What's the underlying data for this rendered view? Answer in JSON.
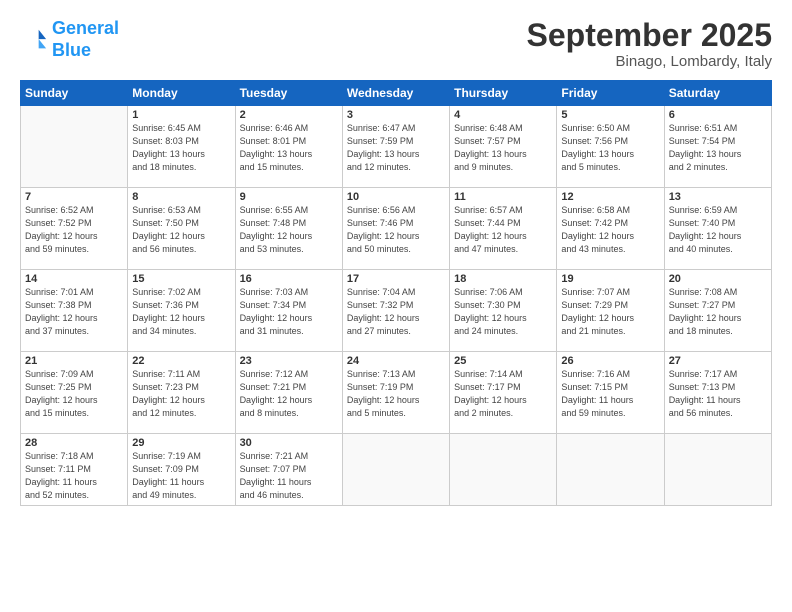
{
  "logo": {
    "line1": "General",
    "line2": "Blue"
  },
  "title": "September 2025",
  "location": "Binago, Lombardy, Italy",
  "days_of_week": [
    "Sunday",
    "Monday",
    "Tuesday",
    "Wednesday",
    "Thursday",
    "Friday",
    "Saturday"
  ],
  "weeks": [
    [
      {
        "day": "",
        "info": ""
      },
      {
        "day": "1",
        "info": "Sunrise: 6:45 AM\nSunset: 8:03 PM\nDaylight: 13 hours\nand 18 minutes."
      },
      {
        "day": "2",
        "info": "Sunrise: 6:46 AM\nSunset: 8:01 PM\nDaylight: 13 hours\nand 15 minutes."
      },
      {
        "day": "3",
        "info": "Sunrise: 6:47 AM\nSunset: 7:59 PM\nDaylight: 13 hours\nand 12 minutes."
      },
      {
        "day": "4",
        "info": "Sunrise: 6:48 AM\nSunset: 7:57 PM\nDaylight: 13 hours\nand 9 minutes."
      },
      {
        "day": "5",
        "info": "Sunrise: 6:50 AM\nSunset: 7:56 PM\nDaylight: 13 hours\nand 5 minutes."
      },
      {
        "day": "6",
        "info": "Sunrise: 6:51 AM\nSunset: 7:54 PM\nDaylight: 13 hours\nand 2 minutes."
      }
    ],
    [
      {
        "day": "7",
        "info": "Sunrise: 6:52 AM\nSunset: 7:52 PM\nDaylight: 12 hours\nand 59 minutes."
      },
      {
        "day": "8",
        "info": "Sunrise: 6:53 AM\nSunset: 7:50 PM\nDaylight: 12 hours\nand 56 minutes."
      },
      {
        "day": "9",
        "info": "Sunrise: 6:55 AM\nSunset: 7:48 PM\nDaylight: 12 hours\nand 53 minutes."
      },
      {
        "day": "10",
        "info": "Sunrise: 6:56 AM\nSunset: 7:46 PM\nDaylight: 12 hours\nand 50 minutes."
      },
      {
        "day": "11",
        "info": "Sunrise: 6:57 AM\nSunset: 7:44 PM\nDaylight: 12 hours\nand 47 minutes."
      },
      {
        "day": "12",
        "info": "Sunrise: 6:58 AM\nSunset: 7:42 PM\nDaylight: 12 hours\nand 43 minutes."
      },
      {
        "day": "13",
        "info": "Sunrise: 6:59 AM\nSunset: 7:40 PM\nDaylight: 12 hours\nand 40 minutes."
      }
    ],
    [
      {
        "day": "14",
        "info": "Sunrise: 7:01 AM\nSunset: 7:38 PM\nDaylight: 12 hours\nand 37 minutes."
      },
      {
        "day": "15",
        "info": "Sunrise: 7:02 AM\nSunset: 7:36 PM\nDaylight: 12 hours\nand 34 minutes."
      },
      {
        "day": "16",
        "info": "Sunrise: 7:03 AM\nSunset: 7:34 PM\nDaylight: 12 hours\nand 31 minutes."
      },
      {
        "day": "17",
        "info": "Sunrise: 7:04 AM\nSunset: 7:32 PM\nDaylight: 12 hours\nand 27 minutes."
      },
      {
        "day": "18",
        "info": "Sunrise: 7:06 AM\nSunset: 7:30 PM\nDaylight: 12 hours\nand 24 minutes."
      },
      {
        "day": "19",
        "info": "Sunrise: 7:07 AM\nSunset: 7:29 PM\nDaylight: 12 hours\nand 21 minutes."
      },
      {
        "day": "20",
        "info": "Sunrise: 7:08 AM\nSunset: 7:27 PM\nDaylight: 12 hours\nand 18 minutes."
      }
    ],
    [
      {
        "day": "21",
        "info": "Sunrise: 7:09 AM\nSunset: 7:25 PM\nDaylight: 12 hours\nand 15 minutes."
      },
      {
        "day": "22",
        "info": "Sunrise: 7:11 AM\nSunset: 7:23 PM\nDaylight: 12 hours\nand 12 minutes."
      },
      {
        "day": "23",
        "info": "Sunrise: 7:12 AM\nSunset: 7:21 PM\nDaylight: 12 hours\nand 8 minutes."
      },
      {
        "day": "24",
        "info": "Sunrise: 7:13 AM\nSunset: 7:19 PM\nDaylight: 12 hours\nand 5 minutes."
      },
      {
        "day": "25",
        "info": "Sunrise: 7:14 AM\nSunset: 7:17 PM\nDaylight: 12 hours\nand 2 minutes."
      },
      {
        "day": "26",
        "info": "Sunrise: 7:16 AM\nSunset: 7:15 PM\nDaylight: 11 hours\nand 59 minutes."
      },
      {
        "day": "27",
        "info": "Sunrise: 7:17 AM\nSunset: 7:13 PM\nDaylight: 11 hours\nand 56 minutes."
      }
    ],
    [
      {
        "day": "28",
        "info": "Sunrise: 7:18 AM\nSunset: 7:11 PM\nDaylight: 11 hours\nand 52 minutes."
      },
      {
        "day": "29",
        "info": "Sunrise: 7:19 AM\nSunset: 7:09 PM\nDaylight: 11 hours\nand 49 minutes."
      },
      {
        "day": "30",
        "info": "Sunrise: 7:21 AM\nSunset: 7:07 PM\nDaylight: 11 hours\nand 46 minutes."
      },
      {
        "day": "",
        "info": ""
      },
      {
        "day": "",
        "info": ""
      },
      {
        "day": "",
        "info": ""
      },
      {
        "day": "",
        "info": ""
      }
    ]
  ]
}
